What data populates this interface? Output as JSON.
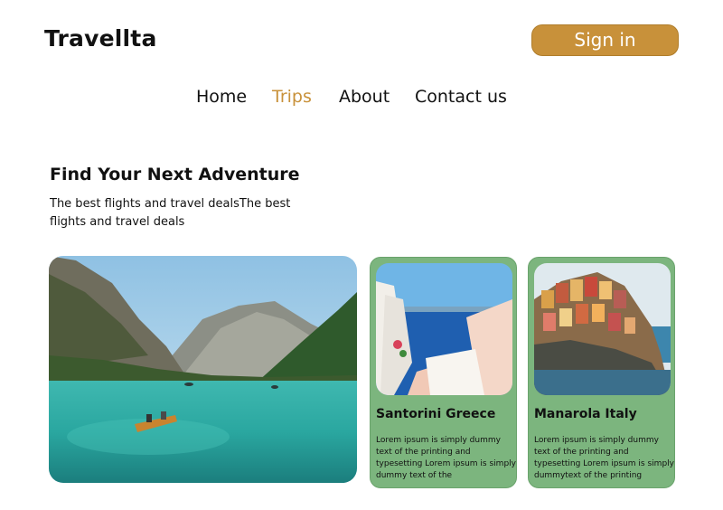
{
  "header": {
    "logo": "Travellta",
    "signin_label": "Sign in"
  },
  "nav": {
    "items": [
      {
        "label": "Home",
        "active": false
      },
      {
        "label": "Trips",
        "active": true
      },
      {
        "label": "About",
        "active": false
      },
      {
        "label": "Contact us",
        "active": false
      }
    ]
  },
  "hero": {
    "title": "Find Your Next Adventure",
    "subtitle": "The best flights and travel dealsThe best flights and travel deals"
  },
  "cards": [
    {
      "title": "Santorini Greece",
      "description": " Lorem ipsum is simply dummy text of the printing and typesetting Lorem ipsum is simply dummy text of the"
    },
    {
      "title": "Manarola Italy",
      "description": " Lorem ipsum is simply dummy text of the printing and typesetting Lorem ipsum is simply dummytext of the printing"
    }
  ],
  "colors": {
    "accent": "#c8913a",
    "card_bg": "#7cb57e",
    "text": "#111111"
  }
}
